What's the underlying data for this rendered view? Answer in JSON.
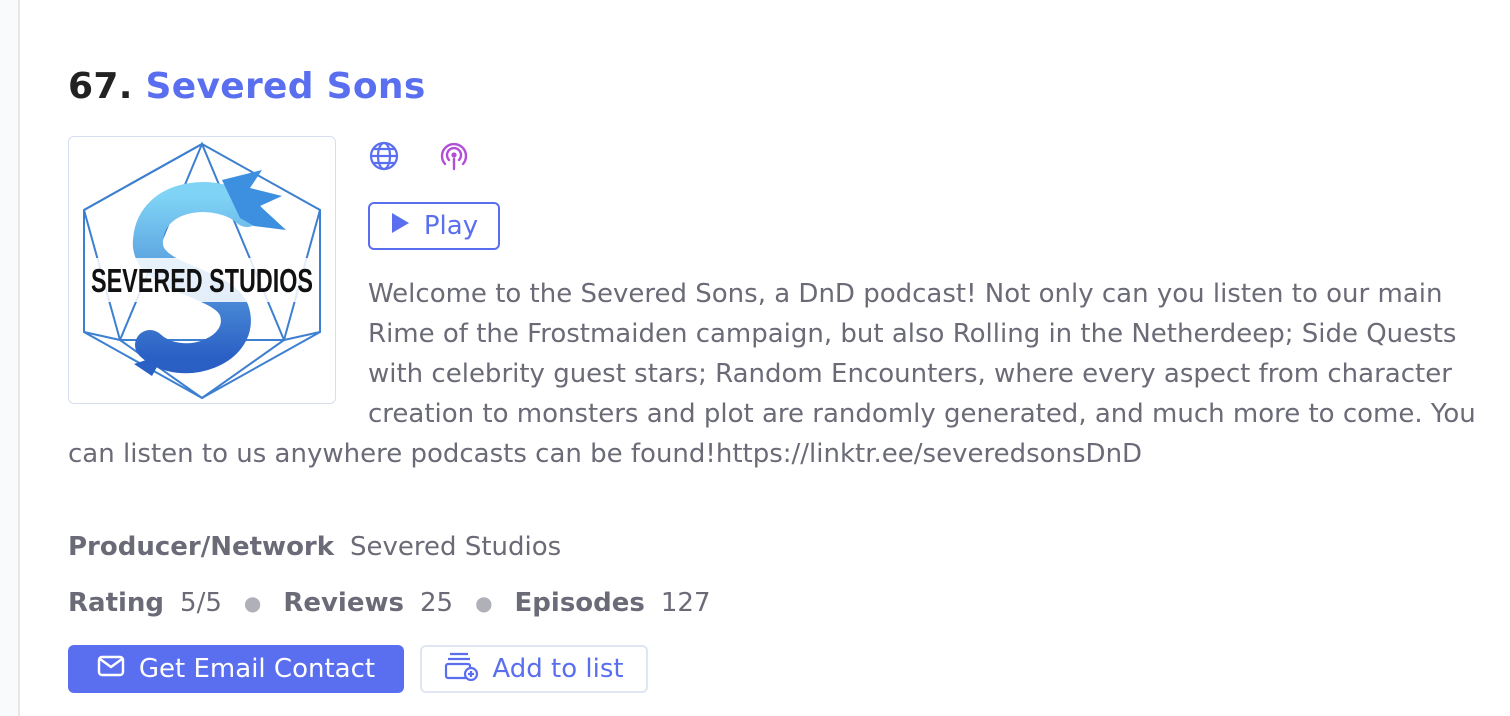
{
  "podcast": {
    "rank": "67.",
    "name": "Severed Sons",
    "cover_text": "SEVERED STUDIOS",
    "description": "Welcome to the Severed Sons, a DnD podcast! Not only can you listen to our main Rime of the Frostmaiden campaign, but also Rolling in the Netherdeep; Side Quests with celebrity guest stars; Random Encounters, where every aspect from character creation to monsters and plot are randomly generated, and much more to come. You can listen to us anywhere podcasts can be found!https://linktr.ee/severedsonsDnD",
    "producer_label": "Producer/Network",
    "producer": "Severed Studios",
    "rating_label": "Rating",
    "rating": "5/5",
    "reviews_label": "Reviews",
    "reviews": "25",
    "episodes_label": "Episodes",
    "episodes": "127"
  },
  "links": {
    "website_icon": "globe-icon",
    "podcast_icon": "podcast-icon"
  },
  "actions": {
    "play_label": "Play",
    "email_label": "Get Email Contact",
    "add_list_label": "Add to list"
  },
  "colors": {
    "accent": "#5a6ff0",
    "podcast_purple": "#b24fd8",
    "text_muted": "#6b6b78",
    "title_dark": "#222222"
  }
}
